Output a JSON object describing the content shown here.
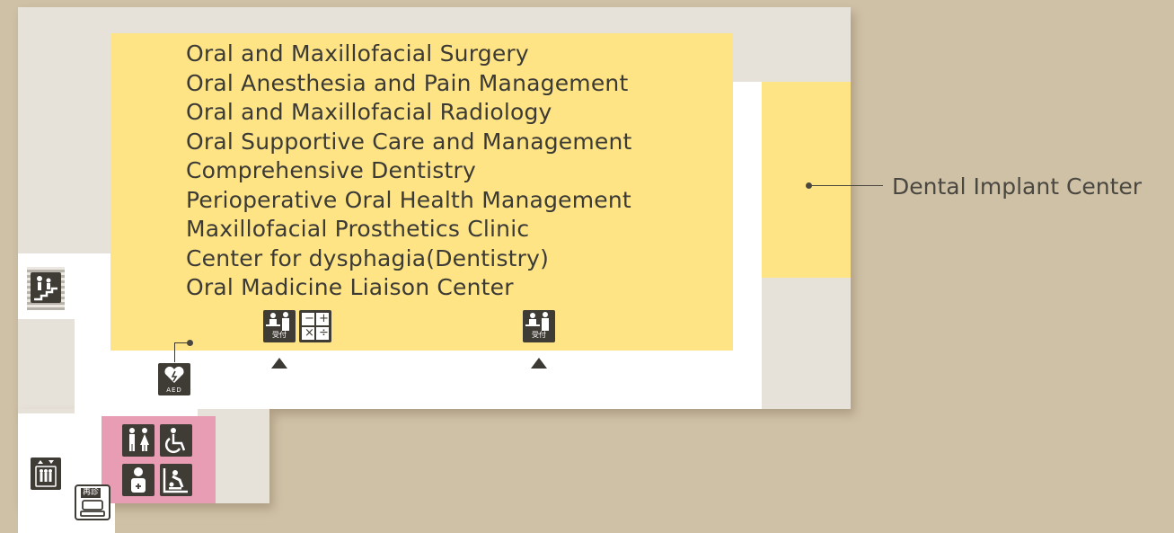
{
  "departments": [
    "Oral and Maxillofacial Surgery",
    "Oral Anesthesia and Pain Management",
    "Oral and Maxillofacial Radiology",
    "Oral Supportive Care and Management",
    "Comprehensive Dentistry",
    "Perioperative Oral Health Management",
    "Maxillofacial Prosthetics Clinic",
    "Center for dysphagia(Dentistry)",
    "Oral Madicine Liaison Center"
  ],
  "callout": {
    "label": "Dental Implant Center"
  },
  "icons": {
    "reception_label": "受付",
    "aed_label": "AED",
    "reentry_label": "再診",
    "cashier_symbols": [
      "−",
      "+",
      "×",
      "÷"
    ]
  },
  "colors": {
    "background": "#cfc1a6",
    "clinic_area": "#ffe486",
    "restroom_area": "#e99db4",
    "corridor": "#ffffff",
    "wall": "#e7e2d9",
    "icon": "#3f3b35"
  }
}
